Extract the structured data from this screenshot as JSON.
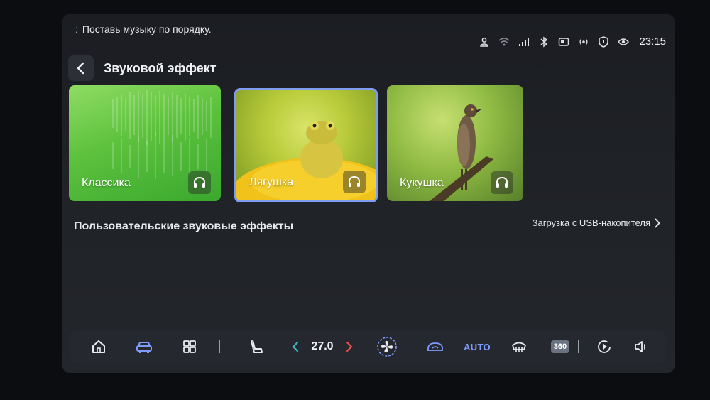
{
  "status_bar": {
    "dots": ":",
    "hint": "Поставь музыку по порядку.",
    "time": "23:15"
  },
  "header": {
    "title": "Звуковой эффект"
  },
  "effects": [
    {
      "label": "Классика"
    },
    {
      "label": "Лягушка"
    },
    {
      "label": "Кукушка"
    }
  ],
  "custom": {
    "title": "Пользовательские звуковые эффекты",
    "usb_label": "Загрузка с USB-накопителя"
  },
  "dock": {
    "temperature": "27.0",
    "auto_label": "AUTO",
    "view360_label": "360"
  },
  "colors": {
    "accent": "#7f9cf0",
    "dock_active": "#7e9cff",
    "temp_left_arrow": "#3fb8c6",
    "temp_right_arrow": "#e5534b"
  },
  "icons": [
    "user-icon",
    "wifi-icon",
    "signal-icon",
    "bluetooth-icon",
    "media-icon",
    "radio-icon",
    "shield-icon",
    "eye-icon",
    "home-icon",
    "car-icon",
    "apps-icon",
    "seat-icon",
    "fan-icon",
    "recirculation-icon",
    "defrost-icon",
    "play-icon",
    "volume-icon"
  ]
}
